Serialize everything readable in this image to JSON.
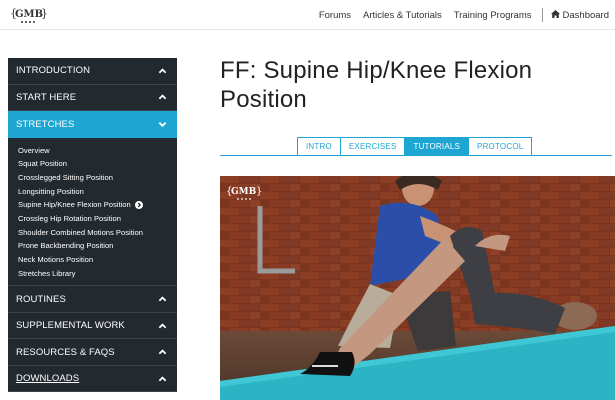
{
  "header": {
    "logo_text": "GMB",
    "nav": [
      "Forums",
      "Articles & Tutorials",
      "Training Programs"
    ],
    "dashboard": "Dashboard",
    "home_icon": "home-icon"
  },
  "sidebar": {
    "sections": [
      {
        "label": "INTRODUCTION",
        "state": "collapsed"
      },
      {
        "label": "START HERE",
        "state": "collapsed"
      },
      {
        "label": "STRETCHES",
        "state": "expanded"
      }
    ],
    "stretches_items": [
      "Overview",
      "Squat Position",
      "Crosslegged Sitting Position",
      "Longsitting Position",
      "Supine Hip/Knee Flexion Position",
      "Crossleg Hip Rotation Position",
      "Shoulder Combined Motions Position",
      "Prone Backbending Position",
      "Neck Motions Position",
      "Stretches Library"
    ],
    "current_item": "Supine Hip/Knee Flexion Position",
    "lower_sections": [
      {
        "label": "ROUTINES"
      },
      {
        "label": "SUPPLEMENTAL WORK"
      },
      {
        "label": "RESOURCES & FAQS"
      },
      {
        "label": "DOWNLOADS"
      }
    ]
  },
  "main": {
    "title": "FF: Supine Hip/Knee Flexion Position",
    "tabs": [
      {
        "label": "INTRO",
        "active": false
      },
      {
        "label": "EXERCISES",
        "active": false
      },
      {
        "label": "TUTORIALS",
        "active": true
      },
      {
        "label": "PROTOCOL",
        "active": false
      }
    ],
    "video_watermark": "GMB"
  },
  "colors": {
    "accent": "#1ea6d3",
    "sidebar_bg": "#22292f",
    "mat": "#2ab4c4",
    "brick": "#8a3a22"
  }
}
